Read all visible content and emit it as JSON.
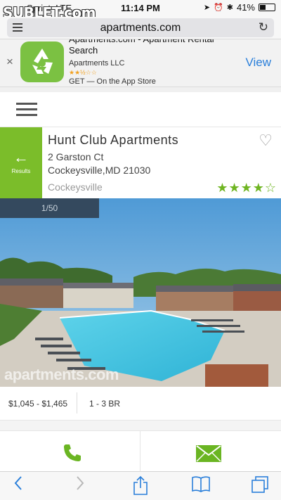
{
  "status_bar": {
    "carrier": "Sprint",
    "network": "LTE",
    "time": "11:14 PM",
    "battery": "41%",
    "battery_level": 0.41,
    "icons": [
      "location-icon",
      "alarm-icon",
      "bluetooth-icon",
      "battery-icon"
    ]
  },
  "watermark": {
    "logo_text": "SUBLET.com"
  },
  "browser": {
    "url": "apartments.com",
    "reader_icon": "reader-icon",
    "reload_icon": "reload-icon"
  },
  "app_banner": {
    "title": "Apartments.com - Apartment Rental Search",
    "vendor": "Apartments LLC",
    "rating_stars": "★★½☆☆",
    "get_text": "GET — On the App Store",
    "view_label": "View",
    "close_glyph": "×",
    "accent_color": "#7bc142"
  },
  "header": {
    "menu_icon": "hamburger-icon"
  },
  "listing": {
    "back_arrow": "←",
    "back_label": "Results",
    "name": "Hunt Club Apartments",
    "address_line1": "2 Garston Ct",
    "address_line2": "Cockeysville,MD 21030",
    "neighborhood": "Cockeysville",
    "favorite_glyph": "♡",
    "rating_stars": "★★★★☆",
    "rating_value": 4,
    "rating_max": 5,
    "accent_color": "#7bbd2a"
  },
  "photo": {
    "counter": "1/50",
    "watermark": "apartments.com"
  },
  "details": {
    "rent": "$1,045 - $1,465",
    "beds": "1 - 3 BR"
  },
  "contact": {
    "call_icon": "phone-icon",
    "email_icon": "envelope-icon",
    "icon_color": "#6ab522"
  },
  "toolbar": {
    "icons": [
      "back-icon",
      "forward-icon",
      "share-icon",
      "bookmarks-icon",
      "tabs-icon"
    ],
    "color": "#2a7fda"
  }
}
